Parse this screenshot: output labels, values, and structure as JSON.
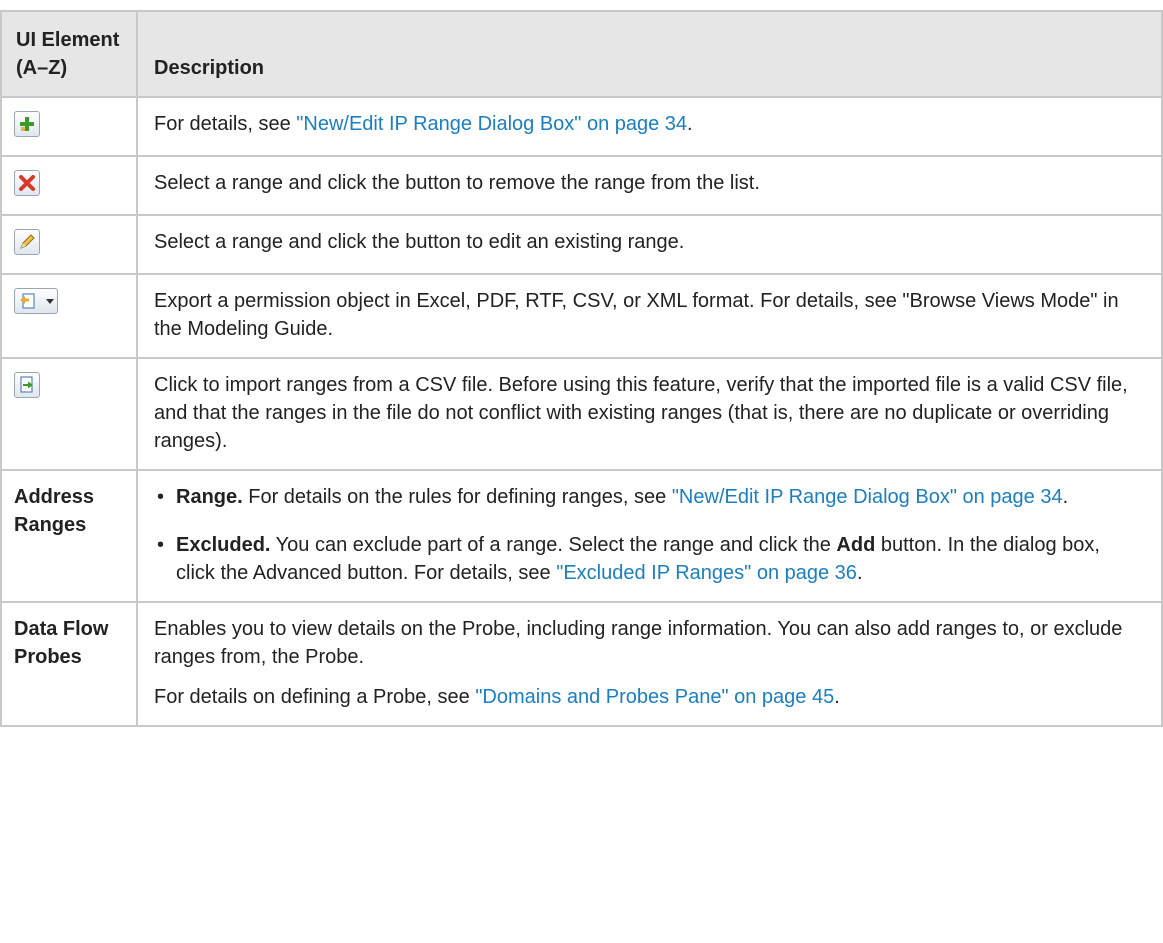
{
  "table": {
    "headers": {
      "element": "UI Element (A–Z)",
      "description": "Description"
    },
    "rows": {
      "add": {
        "icon": "add-icon",
        "before": "For details, see ",
        "link": "\"New/Edit IP Range Dialog Box\" on page 34",
        "after": "."
      },
      "remove": {
        "icon": "delete-icon",
        "text": "Select a range and click the button to remove the range from the list."
      },
      "edit": {
        "icon": "pencil-icon",
        "text": "Select a range and click the button to edit an existing range."
      },
      "export": {
        "icon": "export-dropdown-icon",
        "text": "Export a permission object in Excel, PDF, RTF, CSV, or XML format. For details, see \"Browse Views Mode\" in the Modeling Guide."
      },
      "import": {
        "icon": "import-icon",
        "text": "Click to import ranges from a CSV file. Before using this feature, verify that the imported file is a valid CSV file, and that the ranges in the file do not conflict with existing ranges (that is, there are no duplicate or overriding ranges)."
      },
      "address_ranges": {
        "element": "Address Ranges",
        "range_bold": "Range.",
        "range_text": " For details on the rules for defining ranges, see ",
        "range_link": "\"New/Edit IP Range Dialog Box\" on page 34",
        "range_after": ".",
        "excluded_bold": "Excluded.",
        "excluded_text1": " You can exclude part of a range. Select the range and click the ",
        "excluded_add": "Add",
        "excluded_text2": " button. In the dialog box, click the Advanced button. For details, see ",
        "excluded_link": "\"Excluded IP Ranges\" on page 36",
        "excluded_after": "."
      },
      "data_flow_probes": {
        "element": "Data Flow Probes",
        "text1": "Enables you to view details on the Probe, including range information. You can also add ranges to, or exclude ranges from, the Probe.",
        "text2_before": "For details on defining a Probe, see ",
        "text2_link": "\"Domains and Probes Pane\" on page 45",
        "text2_after": "."
      }
    }
  }
}
